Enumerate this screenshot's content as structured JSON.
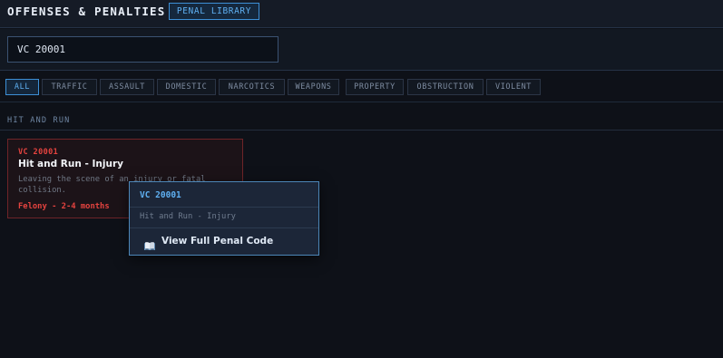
{
  "header": {
    "title": "OFFENSES & PENALTIES",
    "library_button": "PENAL LIBRARY"
  },
  "search": {
    "value": "VC 20001"
  },
  "filters": {
    "chips": [
      "ALL",
      "TRAFFIC",
      "ASSAULT",
      "DOMESTIC",
      "NARCOTICS",
      "WEAPONS",
      "PROPERTY",
      "OBSTRUCTION",
      "VIOLENT"
    ],
    "active": "ALL"
  },
  "section": {
    "label": "HIT AND RUN"
  },
  "offense": {
    "code": "VC 20001",
    "name": "Hit and Run - Injury",
    "description": "Leaving the scene of an injury or fatal collision.",
    "penalty": "Felony - 2-4 months"
  },
  "popup": {
    "code": "VC 20001",
    "name": "Hit and Run - Injury",
    "action_label": "View Full Penal Code",
    "action_icon": "open-book-icon"
  },
  "colors": {
    "accent": "#5fb0f2",
    "felony": "#e5433f",
    "background": "#0e1118"
  }
}
